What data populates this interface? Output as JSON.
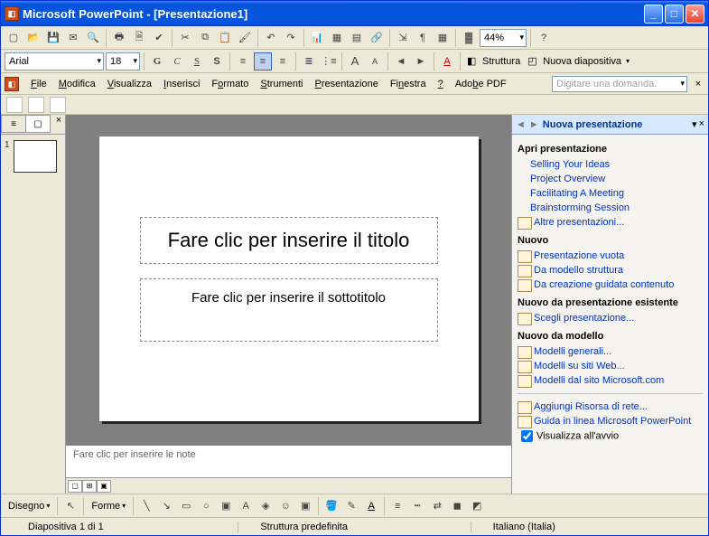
{
  "title": "Microsoft PowerPoint - [Presentazione1]",
  "zoom": "44%",
  "font": {
    "name": "Arial",
    "size": "18"
  },
  "struttura_label": "Struttura",
  "nuova_diap_label": "Nuova diapositiva",
  "menu": {
    "file": "File",
    "modifica": "Modifica",
    "visualizza": "Visualizza",
    "inserisci": "Inserisci",
    "formato": "Formato",
    "strumenti": "Strumenti",
    "presentazione": "Presentazione",
    "finestra": "Finestra",
    "help": "?",
    "adobe": "Adobe PDF"
  },
  "help_placeholder": "Digitare una domanda.",
  "thumb_num": "1",
  "slide": {
    "title": "Fare clic per inserire il titolo",
    "subtitle": "Fare clic per inserire il sottotitolo"
  },
  "notes": "Fare clic per inserire le note",
  "taskpane": {
    "title": "Nuova presentazione",
    "sec_open": "Apri presentazione",
    "recent": [
      "Selling Your Ideas",
      "Project Overview",
      "Facilitating A Meeting",
      "Brainstorming Session"
    ],
    "more": "Altre presentazioni...",
    "sec_new": "Nuovo",
    "new_items": [
      "Presentazione vuota",
      "Da modello struttura",
      "Da creazione guidata contenuto"
    ],
    "sec_existing": "Nuovo da presentazione esistente",
    "choose": "Scegli presentazione...",
    "sec_template": "Nuovo da modello",
    "templates": [
      "Modelli generali...",
      "Modelli su siti Web...",
      "Modelli dal sito Microsoft.com"
    ],
    "add_net": "Aggiungi Risorsa di rete...",
    "help": "Guida in linea Microsoft PowerPoint",
    "show_startup": "Visualizza all'avvio"
  },
  "draw": {
    "disegno": "Disegno",
    "forme": "Forme"
  },
  "status": {
    "slide": "Diapositiva 1 di 1",
    "design": "Struttura predefinita",
    "lang": "Italiano (Italia)"
  }
}
